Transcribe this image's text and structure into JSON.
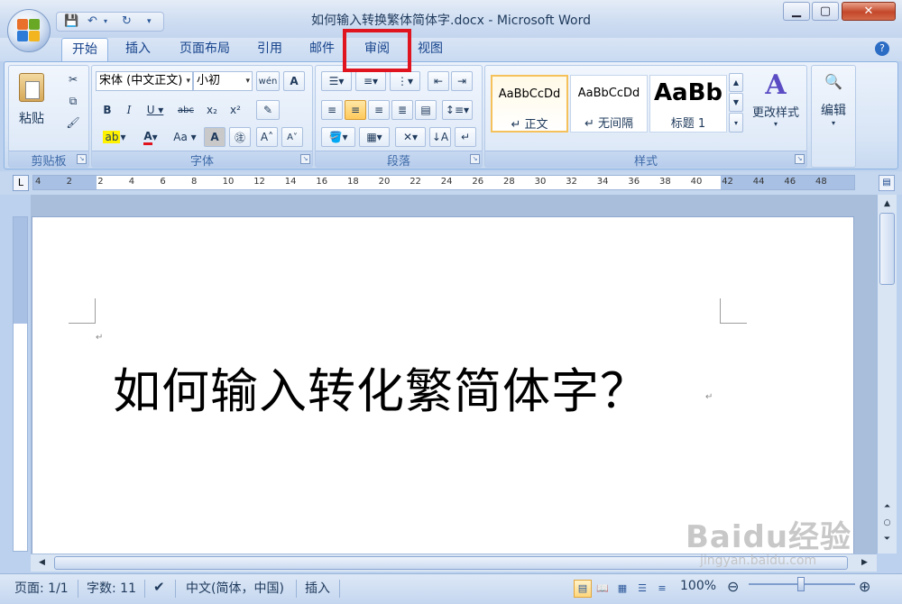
{
  "window": {
    "title": "如何输入转换繁体简体字.docx - Microsoft Word"
  },
  "tabs": [
    {
      "label": "开始",
      "active": true
    },
    {
      "label": "插入",
      "active": false
    },
    {
      "label": "页面布局",
      "active": false
    },
    {
      "label": "引用",
      "active": false
    },
    {
      "label": "邮件",
      "active": false
    },
    {
      "label": "审阅",
      "active": false,
      "highlighted": true
    },
    {
      "label": "视图",
      "active": false
    }
  ],
  "ribbon": {
    "clipboard": {
      "label": "剪贴板",
      "paste_label": "粘贴"
    },
    "font": {
      "label": "字体",
      "font_name": "宋体 (中文正文)",
      "font_size": "小初"
    },
    "paragraph": {
      "label": "段落"
    },
    "styles": {
      "label": "样式",
      "items": [
        {
          "sample": "AaBbCcDd",
          "name": "↵ 正文",
          "selected": true
        },
        {
          "sample": "AaBbCcDd",
          "name": "↵ 无间隔",
          "selected": false
        },
        {
          "sample": "AaBb",
          "name": "标题 1",
          "selected": false
        }
      ],
      "change_label": "更改样式"
    },
    "editing": {
      "label": "编辑"
    }
  },
  "ruler": {
    "corner": "L",
    "labels": [
      "4",
      "2",
      "2",
      "4",
      "6",
      "8",
      "10",
      "12",
      "14",
      "16",
      "18",
      "20",
      "22",
      "24",
      "26",
      "28",
      "30",
      "32",
      "34",
      "36",
      "38",
      "40",
      "42",
      "44",
      "46",
      "48"
    ]
  },
  "document": {
    "heading": "如何输入转化繁简体字？"
  },
  "statusbar": {
    "page": "页面: 1/1",
    "words": "字数: 11",
    "language": "中文(简体，中国)",
    "mode": "插入",
    "zoom": "100%"
  },
  "watermark": {
    "logo": "Baidu经验",
    "url": "jingyan.baidu.com"
  },
  "colors": {
    "highlight_box": "#e0141e",
    "ribbon_text": "#15428b"
  }
}
